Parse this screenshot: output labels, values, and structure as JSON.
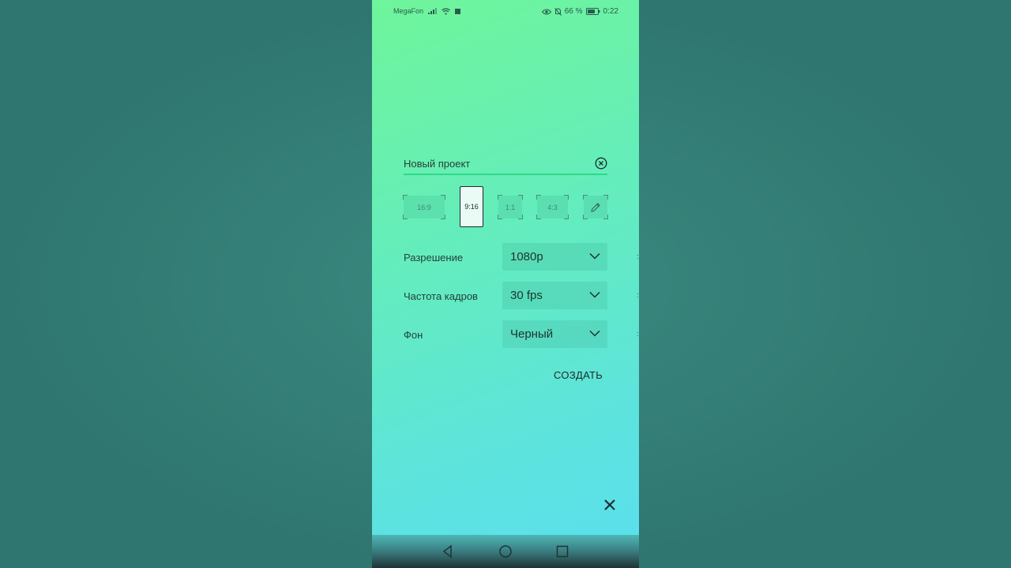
{
  "status_bar": {
    "carrier": "MegaFon",
    "battery_percent": "66 %",
    "time": "0:22"
  },
  "project": {
    "name": "Новый проект"
  },
  "aspect_ratios": {
    "options": [
      "16:9",
      "9:16",
      "1:1",
      "4:3"
    ],
    "selected": "9:16"
  },
  "settings": {
    "resolution": {
      "label": "Разрешение",
      "value": "1080p"
    },
    "framerate": {
      "label": "Частота кадров",
      "value": "30 fps"
    },
    "background": {
      "label": "Фон",
      "value": "Черный"
    }
  },
  "actions": {
    "create_label": "СОЗДАТЬ"
  },
  "icons": {
    "clear": "close-circle-icon",
    "custom_ratio": "pencil-icon",
    "close": "close-icon",
    "dropdown": "chevron-down-icon",
    "nav": [
      "back-icon",
      "home-icon",
      "recents-icon"
    ]
  },
  "colors": {
    "gradient_top": "#6ff59a",
    "gradient_bottom": "#5adff0",
    "accent_line": "#2fd889",
    "outer_background": "#357b74"
  }
}
